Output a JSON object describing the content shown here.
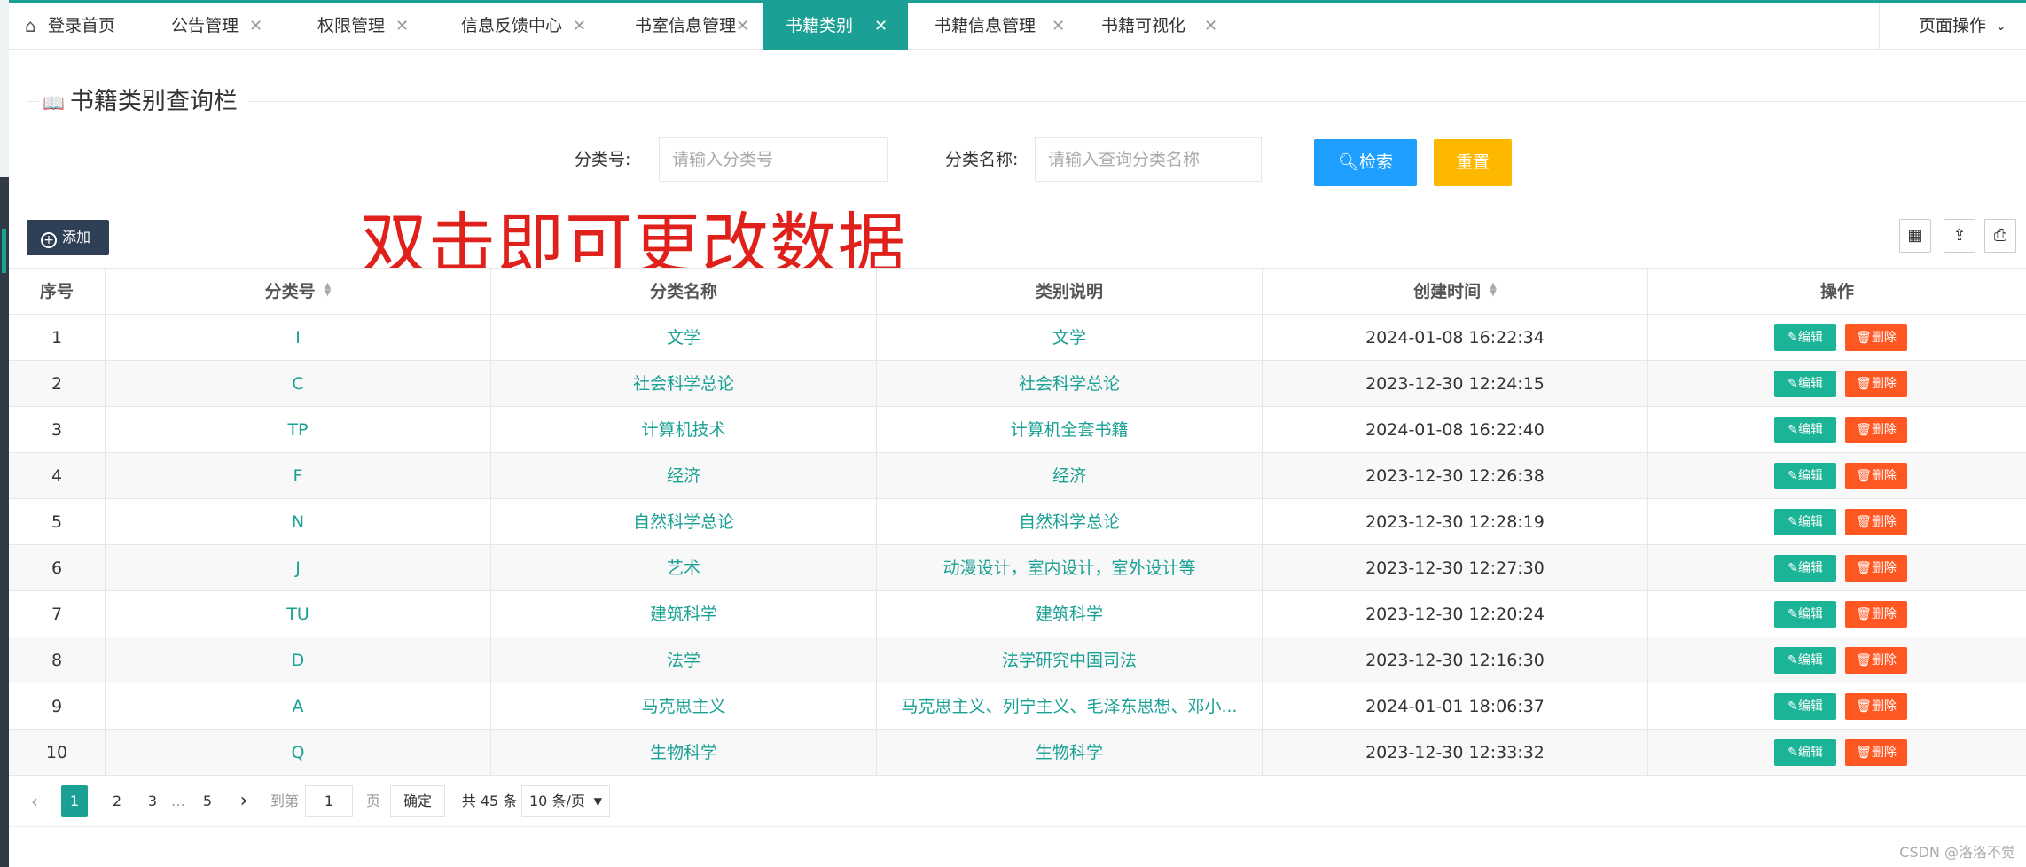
{
  "tabs": [
    {
      "label": "登录首页",
      "closable": false,
      "icon": "home-icon"
    },
    {
      "label": "公告管理",
      "closable": true
    },
    {
      "label": "权限管理",
      "closable": true
    },
    {
      "label": "信息反馈中心",
      "closable": true
    },
    {
      "label": "书室信息管理",
      "closable": true
    },
    {
      "label": "书籍类别",
      "closable": true,
      "active": true
    },
    {
      "label": "书籍信息管理",
      "closable": true
    },
    {
      "label": "书籍可视化",
      "closable": true
    }
  ],
  "page_ops_label": "页面操作",
  "close_glyph": "✕",
  "search": {
    "title": "书籍类别查询栏",
    "code_label": "分类号:",
    "code_placeholder": "请输入分类号",
    "name_label": "分类名称:",
    "name_placeholder": "请输入查询分类名称",
    "search_button": "检索",
    "reset_button": "重置"
  },
  "toolbar": {
    "add_button": "添加",
    "annotation": "双击即可更改数据",
    "icons": [
      "columns-icon",
      "export-icon",
      "print-icon"
    ]
  },
  "table": {
    "headers": [
      "序号",
      "分类号",
      "分类名称",
      "类别说明",
      "创建时间",
      "操作"
    ],
    "edit_label": "编辑",
    "delete_label": "删除",
    "rows": [
      {
        "no": "1",
        "code": "I",
        "name": "文学",
        "desc": "文学",
        "time": "2024-01-08 16:22:34"
      },
      {
        "no": "2",
        "code": "C",
        "name": "社会科学总论",
        "desc": "社会科学总论",
        "time": "2023-12-30 12:24:15"
      },
      {
        "no": "3",
        "code": "TP",
        "name": "计算机技术",
        "desc": "计算机全套书籍",
        "time": "2024-01-08 16:22:40"
      },
      {
        "no": "4",
        "code": "F",
        "name": "经济",
        "desc": "经济",
        "time": "2023-12-30 12:26:38"
      },
      {
        "no": "5",
        "code": "N",
        "name": "自然科学总论",
        "desc": "自然科学总论",
        "time": "2023-12-30 12:28:19"
      },
      {
        "no": "6",
        "code": "J",
        "name": "艺术",
        "desc": "动漫设计，室内设计，室外设计等",
        "time": "2023-12-30 12:27:30"
      },
      {
        "no": "7",
        "code": "TU",
        "name": "建筑科学",
        "desc": "建筑科学",
        "time": "2023-12-30 12:20:24"
      },
      {
        "no": "8",
        "code": "D",
        "name": "法学",
        "desc": "法学研究中国司法",
        "time": "2023-12-30 12:16:30"
      },
      {
        "no": "9",
        "code": "A",
        "name": "马克思主义",
        "desc": "马克思主义、列宁主义、毛泽东思想、邓小...",
        "time": "2024-01-01 18:06:37"
      },
      {
        "no": "10",
        "code": "Q",
        "name": "生物科学",
        "desc": "生物科学",
        "time": "2023-12-30 12:33:32"
      }
    ]
  },
  "pagination": {
    "pages": [
      "1",
      "2",
      "3",
      "…",
      "5"
    ],
    "current": "1",
    "goto_prefix": "到第",
    "goto_value": "1",
    "goto_suffix": "页",
    "confirm": "确定",
    "total": "共 45 条",
    "page_size": "10 条/页"
  },
  "watermark": "CSDN @洛洛不觉",
  "colors": {
    "accent": "#1aa094",
    "search_button": "#1e9fff",
    "reset_button": "#ffb800",
    "add_button": "#2f4056",
    "delete_button": "#ff5722",
    "annotation": "#e0211b"
  }
}
